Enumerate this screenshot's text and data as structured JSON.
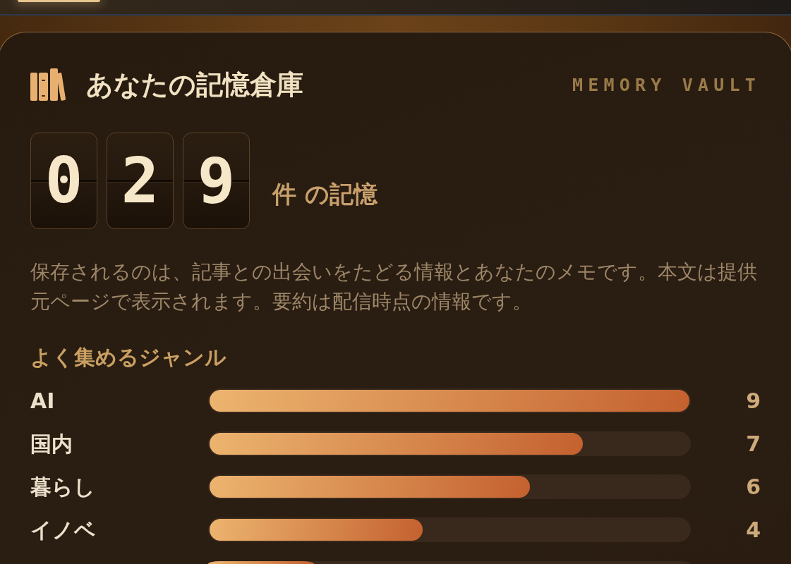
{
  "vault": {
    "title": "あなたの記憶倉庫",
    "subtitle": "MEMORY VAULT",
    "counter": {
      "digits": [
        "0",
        "2",
        "9"
      ],
      "unit": "件 の記憶"
    },
    "description": "保存されるのは、記事との出会いをたどる情報とあなたのメモです。本文は提供元ページで表示されます。要約は配信時点の情報です。",
    "genres_heading": "よく集めるジャンル",
    "genres": [
      {
        "kind": "full",
        "label": "AI",
        "level": 1,
        "count": "9"
      },
      {
        "kind": "full",
        "label": "国内",
        "level": 0.778,
        "count": "7"
      },
      {
        "kind": "full",
        "label": "暮らし",
        "level": 0.667,
        "count": "6"
      },
      {
        "kind": "full",
        "label": "イノベ",
        "level": 0.444,
        "count": "4"
      },
      {
        "kind": "cut_off",
        "level": 0.22
      }
    ]
  }
}
